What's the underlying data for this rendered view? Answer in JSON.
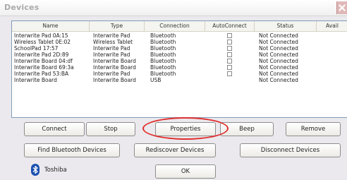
{
  "window": {
    "title": "Devices",
    "close_icon": "close-icon"
  },
  "table": {
    "columns": [
      "Name",
      "Type",
      "Connection",
      "AutoConnect",
      "Status",
      "Avail"
    ],
    "rows": [
      {
        "name": "Interwrite Pad 0A:15",
        "type": "Interwrite Pad",
        "connection": "Bluetooth",
        "autoconnect": false,
        "status": "Not Connected"
      },
      {
        "name": "Wireless Tablet 0E:02",
        "type": "Wireless Tablet",
        "connection": "Bluetooth",
        "autoconnect": false,
        "status": "Not Connected"
      },
      {
        "name": "SchoolPad 17:57",
        "type": "Interwrite Pad",
        "connection": "Bluetooth",
        "autoconnect": false,
        "status": "Not Connected"
      },
      {
        "name": "Interwrite Pad 2D:89",
        "type": "Interwrite Pad",
        "connection": "Bluetooth",
        "autoconnect": false,
        "status": "Not Connected"
      },
      {
        "name": "Interwrite Board 04:df",
        "type": "Interwrite Board",
        "connection": "Bluetooth",
        "autoconnect": false,
        "status": "Not Connected"
      },
      {
        "name": "Interwrite Board 69:3a",
        "type": "Interwrite Board",
        "connection": "Bluetooth",
        "autoconnect": false,
        "status": "Not Connected"
      },
      {
        "name": "Interwrite Pad 53:BA",
        "type": "Interwrite Pad",
        "connection": "Bluetooth",
        "autoconnect": false,
        "status": "Not Connected"
      },
      {
        "name": "Interwrite Board",
        "type": "Interwrite Board",
        "connection": "USB",
        "autoconnect": null,
        "status": "Not Connected"
      }
    ]
  },
  "buttons": {
    "connect": "Connect",
    "stop": "Stop",
    "properties": "Properties",
    "beep": "Beep",
    "remove": "Remove",
    "find_bluetooth": "Find Bluetooth Devices",
    "rediscover": "Rediscover Devices",
    "disconnect": "Disconnect Devices",
    "ok": "OK"
  },
  "footer": {
    "bluetooth_icon": "bluetooth-icon",
    "stack_label": "Toshiba"
  },
  "annotation": {
    "highlight_color": "#e03030"
  }
}
